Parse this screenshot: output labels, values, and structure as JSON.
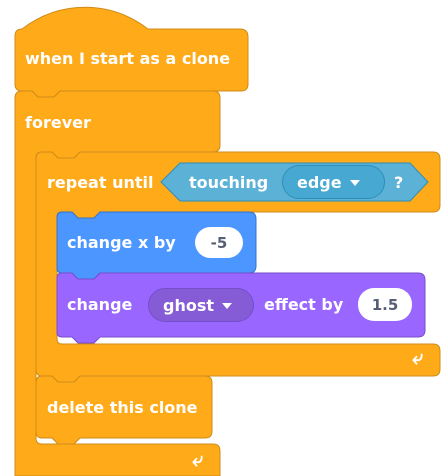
{
  "colors": {
    "control": "#ffab19",
    "control_edge": "#cf8b17",
    "sensing": "#5cb1d6",
    "sensing_edge": "#2e8eb8",
    "sensing_dark": "#47a8d1",
    "motion": "#4c97ff",
    "motion_edge": "#3373cc",
    "looks": "#9966ff",
    "looks_edge": "#774dcb",
    "looks_dark": "#855cd6"
  },
  "hat_block": {
    "label": "when I start as a clone"
  },
  "forever_block": {
    "label": "forever",
    "loop_icon": "loop-arrow-icon"
  },
  "repeat_until_block": {
    "label": "repeat until",
    "loop_icon": "loop-arrow-icon",
    "condition": {
      "label": "touching",
      "target": "edge",
      "suffix": "?",
      "dropdown_icon": "caret-down-icon"
    }
  },
  "change_x_block": {
    "label": "change x by",
    "value": "-5"
  },
  "change_effect_block": {
    "label": "change",
    "effect": "ghost",
    "label_after": "effect by",
    "value": "1.5",
    "dropdown_icon": "caret-down-icon"
  },
  "delete_clone_block": {
    "label": "delete this clone"
  }
}
